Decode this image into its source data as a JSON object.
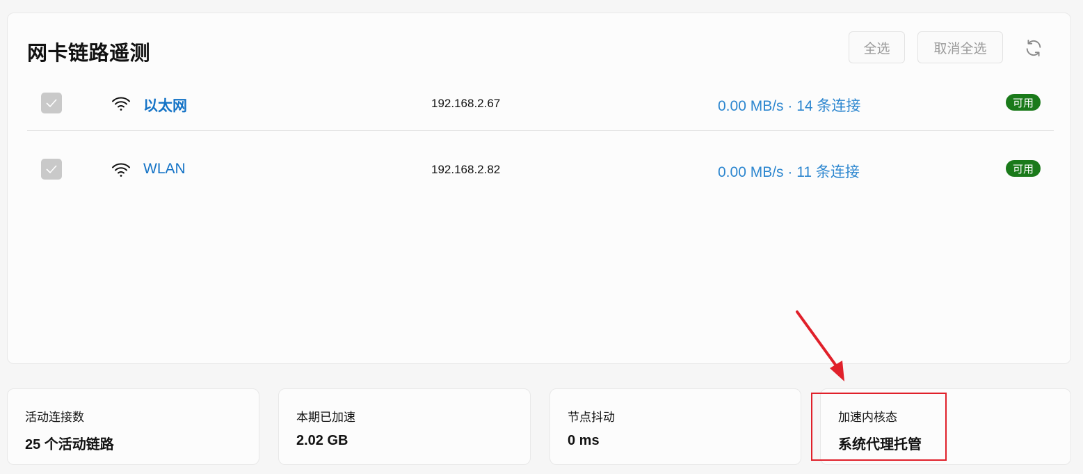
{
  "panel": {
    "title": "网卡链路遥测",
    "select_all_label": "全选",
    "deselect_all_label": "取消全选",
    "refresh_icon": "refresh-icon"
  },
  "interfaces": [
    {
      "name": "以太网",
      "ip": "192.168.2.67",
      "speed": "0.00 MB/s · 14 条连接",
      "status": "可用",
      "checked": true
    },
    {
      "name": "WLAN",
      "ip": "192.168.2.82",
      "speed": "0.00 MB/s · 11 条连接",
      "status": "可用",
      "checked": true
    }
  ],
  "stats": [
    {
      "label": "活动连接数",
      "value": "25 个活动链路"
    },
    {
      "label": "本期已加速",
      "value": "2.02 GB"
    },
    {
      "label": "节点抖动",
      "value": "0 ms"
    },
    {
      "label": "加速内核态",
      "value": "系统代理托管"
    }
  ],
  "colors": {
    "link": "#1473c6",
    "status_ok": "#1a7a1a",
    "annotation": "#e0202a"
  }
}
